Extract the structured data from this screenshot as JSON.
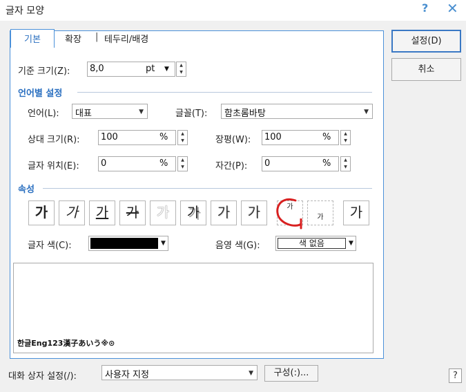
{
  "window": {
    "title": "글자 모양",
    "help_glyph": "?",
    "close_glyph": "✕"
  },
  "tabs": {
    "basic": "기본",
    "extended": "확장",
    "separator": "|",
    "border": "테두리/배경"
  },
  "base_size": {
    "label": "기준 크기(Z):",
    "value": "8,0",
    "unit": "pt"
  },
  "lang_section": {
    "title": "언어별 설정"
  },
  "language": {
    "label": "언어(L):",
    "value": "대표"
  },
  "font": {
    "label": "글꼴(T):",
    "value": "함초롬바탕"
  },
  "relative_size": {
    "label": "상대 크기(R):",
    "value": "100",
    "unit": "%"
  },
  "width_ratio": {
    "label": "장평(W):",
    "value": "100",
    "unit": "%"
  },
  "position": {
    "label": "글자 위치(E):",
    "value": "0",
    "unit": "%"
  },
  "spacing": {
    "label": "자간(P):",
    "value": "0",
    "unit": "%"
  },
  "attr_section": {
    "title": "속성"
  },
  "attributes": [
    "가",
    "가",
    "가",
    "가",
    "가",
    "가",
    "가",
    "가",
    "가",
    "가",
    "가"
  ],
  "text_color": {
    "label": "글자 색(C):",
    "value": "#000000"
  },
  "shade_color": {
    "label": "음영 색(G):",
    "value": "색 없음"
  },
  "preview": {
    "sample": "한글Eng123漢子あいう※⊙"
  },
  "dialog_setting": {
    "label": "대화 상자 설정(/):",
    "value": "사용자 지정",
    "config_label": "구성(:)..."
  },
  "buttons": {
    "ok": "설정(D)",
    "cancel": "취소",
    "help": "?"
  },
  "colors": {
    "accent": "#2a6fc0",
    "tab_border": "#4a90d9",
    "annotation": "#d82020"
  }
}
